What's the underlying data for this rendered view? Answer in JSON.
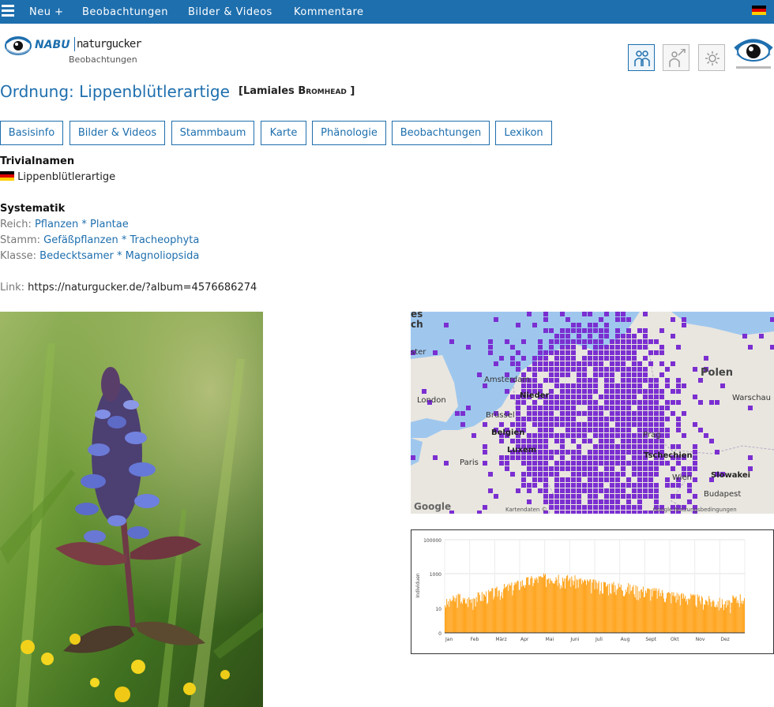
{
  "nav": {
    "menu_icon": "hamburger-menu-icon",
    "items": [
      "Neu +",
      "Beobachtungen",
      "Bilder & Videos",
      "Kommentare"
    ],
    "language_flag": "german-flag-icon"
  },
  "logo": {
    "brand": "NABU",
    "name": "naturgucker",
    "subtitle": "Beobachtungen"
  },
  "tools": {
    "icons": [
      "people-icon",
      "person-arrow-icon",
      "settings-gear-icon"
    ]
  },
  "title": {
    "main": "Ordnung: Lippenblütlerartige",
    "sci_open": "[Lamiales ",
    "author": "Bromhead",
    "sci_close": " ]"
  },
  "tabs": [
    "Basisinfo",
    "Bilder & Videos",
    "Stammbaum",
    "Karte",
    "Phänologie",
    "Beobachtungen",
    "Lexikon"
  ],
  "trivial": {
    "heading": "Trivialnamen",
    "name": "Lippenblütlerartige"
  },
  "systematik": {
    "heading": "Systematik",
    "rows": [
      {
        "label": "Reich:",
        "value": "Pflanzen * Plantae"
      },
      {
        "label": "Stamm:",
        "value": "Gefäßpflanzen * Tracheophyta"
      },
      {
        "label": "Klasse:",
        "value": "Bedecktsamer * Magnoliopsida"
      }
    ]
  },
  "link": {
    "label": "Link:",
    "url": "https://naturgucker.de/?album=4576686274"
  },
  "map": {
    "cities": {
      "london": "London",
      "amsterdam": "Amsterdam",
      "bruessel": "Brüssel",
      "belgien": "Belgien",
      "luxemburg": "Luxem",
      "paris": "Paris",
      "polen": "Polen",
      "warschau": "Warschau",
      "prag": "Prag",
      "tschechien": "Tschechien",
      "wien": "Wien",
      "slowakei": "Slowakei",
      "budapest": "Budapest",
      "nieder": "Nieder",
      "top1": "es",
      "top2": "ch",
      "left": "ster"
    },
    "google": "Google",
    "footer": "Kartendaten ©",
    "footer2": "...Google  Nutzungsbedingungen",
    "overlay_color": "#7b2fd1"
  },
  "chart_data": {
    "type": "bar",
    "ylabel": "Individuen",
    "yscale": "log",
    "yticks": [
      "100000",
      "1000",
      "10",
      "0"
    ],
    "months": [
      "Jan",
      "Feb",
      "März",
      "Apr",
      "Mai",
      "Juni",
      "Juli",
      "Aug",
      "Sept",
      "Okt",
      "Nov",
      "Dez"
    ],
    "bar_color": "#ffa51f",
    "note": "daily counts, roughly 30-1000 individuals per day, peak in June",
    "weekly_values": [
      40,
      60,
      80,
      50,
      60,
      90,
      100,
      120,
      150,
      180,
      250,
      300,
      400,
      500,
      600,
      700,
      800,
      900,
      1200,
      1100,
      900,
      800,
      700,
      600,
      500,
      450,
      400,
      380,
      350,
      330,
      300,
      280,
      250,
      220,
      200,
      180,
      160,
      140,
      120,
      110,
      100,
      90,
      80,
      70,
      60,
      55,
      50,
      45,
      40,
      35,
      60,
      80
    ]
  }
}
